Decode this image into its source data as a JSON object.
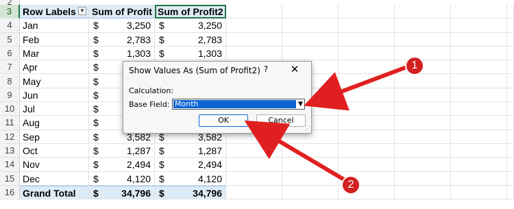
{
  "sheet": {
    "partial_row": "2",
    "rows": [
      {
        "num": "3",
        "label": "Row Labels",
        "p1": "Sum of Profit",
        "p2": "Sum of Profit2",
        "type": "header"
      },
      {
        "num": "4",
        "label": "Jan",
        "p1": "3,250",
        "p2": "3,250"
      },
      {
        "num": "5",
        "label": "Feb",
        "p1": "2,783",
        "p2": "2,783"
      },
      {
        "num": "6",
        "label": "Mar",
        "p1": "1,303",
        "p2": "1,303"
      },
      {
        "num": "7",
        "label": "Apr",
        "p1": "",
        "p2": ""
      },
      {
        "num": "8",
        "label": "May",
        "p1": "",
        "p2": ""
      },
      {
        "num": "9",
        "label": "Jun",
        "p1": "",
        "p2": ""
      },
      {
        "num": "10",
        "label": "Jul",
        "p1": "",
        "p2": ""
      },
      {
        "num": "11",
        "label": "Aug",
        "p1": "",
        "p2": ""
      },
      {
        "num": "12",
        "label": "Sep",
        "p1": "3,582",
        "p2": "3,582"
      },
      {
        "num": "13",
        "label": "Oct",
        "p1": "1,287",
        "p2": "1,287"
      },
      {
        "num": "14",
        "label": "Nov",
        "p1": "2,494",
        "p2": "2,494"
      },
      {
        "num": "15",
        "label": "Dec",
        "p1": "4,120",
        "p2": "4,120"
      },
      {
        "num": "16",
        "label": "Grand Total",
        "p1": "34,796",
        "p2": "34,796",
        "type": "total"
      }
    ],
    "currency_symbol": "$",
    "filter_icon": "dropdown-filter-icon",
    "header_color": "#ddebf7",
    "selection_color": "#217346"
  },
  "dialog": {
    "title": "Show Values As (Sum of Profit2)",
    "help": "?",
    "close": "✕",
    "calculation_label": "Calculation:",
    "base_field_label": "Base Field:",
    "base_field_value": "Month",
    "ok_label": "OK",
    "cancel_label": "Cancel"
  },
  "callouts": {
    "one": "1",
    "two": "2",
    "color": "#d32020"
  }
}
